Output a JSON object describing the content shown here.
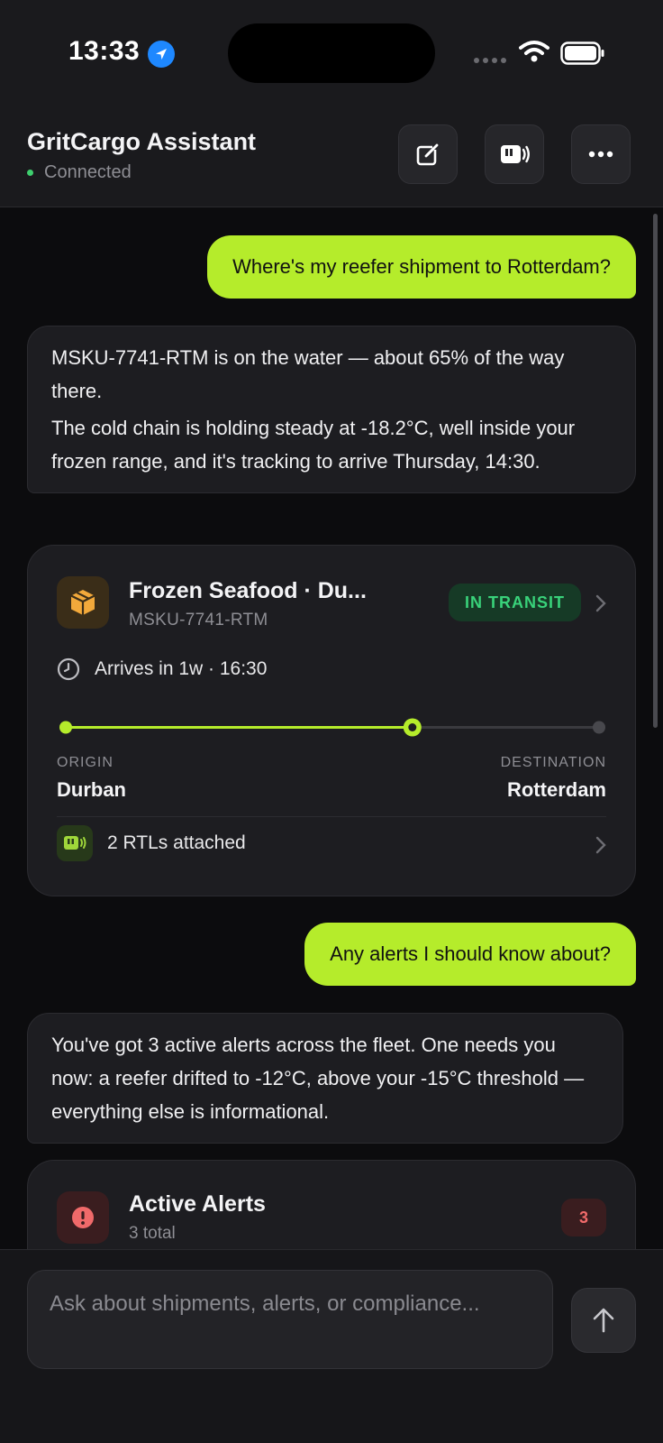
{
  "status_bar": {
    "time": "13:33",
    "location_icon": "location-arrow-icon",
    "wifi_icon": "wifi-icon",
    "battery_icon": "battery-icon"
  },
  "header": {
    "title": "GritCargo Assistant",
    "connection_status": "Connected",
    "status_color": "#3ecf6e",
    "buttons": [
      {
        "name": "new-chat-button",
        "icon": "compose-icon"
      },
      {
        "name": "rtl-device-button",
        "icon": "rtl-device-icon"
      },
      {
        "name": "more-options-button",
        "icon": "ellipsis-icon"
      }
    ]
  },
  "messages": [
    {
      "role": "user",
      "text": "Where's my reefer shipment to Rotterdam?"
    },
    {
      "role": "assistant",
      "paragraphs": [
        "MSKU-7741-RTM is on the water — about 65% of the way there.",
        "The cold chain is holding steady at -18.2°C, well inside your frozen range, and it's tracking to arrive Thursday, 14:30."
      ]
    },
    {
      "role": "user",
      "text": "Any alerts I should know about?"
    },
    {
      "role": "assistant",
      "paragraphs": [
        "You've got 3 active alerts across the fleet. One needs you now: a reefer drifted to -12°C, above your -15°C threshold — everything else is informational."
      ]
    }
  ],
  "shipment_card": {
    "title": "Frozen Seafood · Du...",
    "container_id": "MSKU-7741-RTM",
    "status": "IN TRANSIT",
    "eta": "Arrives in 1w · 16:30",
    "progress": 0.65,
    "origin_label": "ORIGIN",
    "origin": "Durban",
    "destination_label": "DESTINATION",
    "destination": "Rotterdam",
    "rtl_text": "2 RTLs attached",
    "accent_color": "#b5ec2b",
    "status_color": "#39d27a"
  },
  "alerts_card": {
    "title": "Active Alerts",
    "subtitle": "3 total",
    "count": "3",
    "color": "#f06a6a"
  },
  "composer": {
    "placeholder": "Ask about shipments, alerts, or compliance...",
    "send_icon": "arrow-up-icon"
  }
}
